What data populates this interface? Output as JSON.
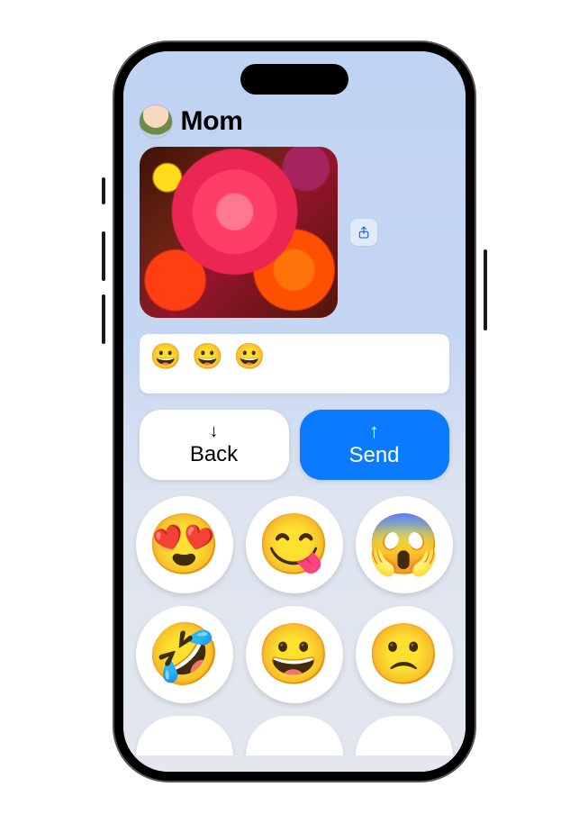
{
  "header": {
    "contact_name": "Mom"
  },
  "message": {
    "attachment_kind": "photo",
    "attachment_description": "flowers"
  },
  "input": {
    "value": "😀 😀 😀"
  },
  "actions": {
    "back_label": "Back",
    "back_arrow": "↓",
    "send_label": "Send",
    "send_arrow": "↑"
  },
  "emoji_keyboard": [
    "😍",
    "😋",
    "😱",
    "🤣",
    "😀",
    "🙁"
  ],
  "colors": {
    "accent": "#0a7aff"
  }
}
